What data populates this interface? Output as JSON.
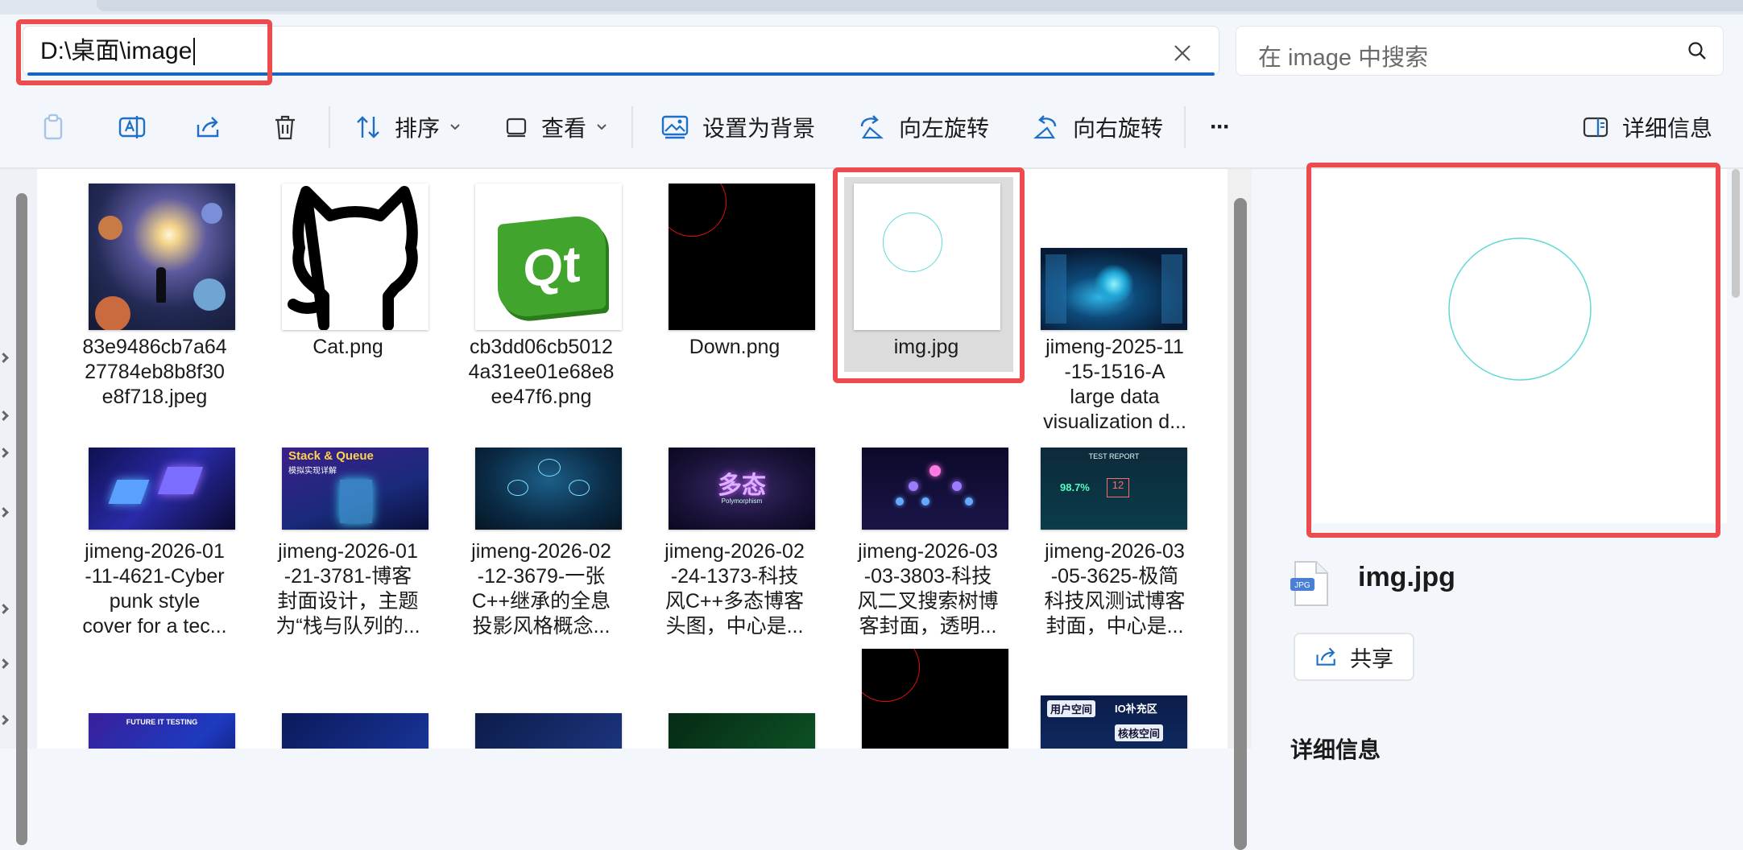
{
  "address": {
    "path": "D:\\桌面\\image",
    "clear_icon": "close-icon"
  },
  "search": {
    "placeholder": "在 image 中搜索",
    "icon": "search-icon"
  },
  "toolbar": {
    "sort_label": "排序",
    "view_label": "查看",
    "set_background_label": "设置为背景",
    "rotate_left_label": "向左旋转",
    "rotate_right_label": "向右旋转",
    "more_label": "···",
    "details_label": "详细信息"
  },
  "files": [
    {
      "name": "83e9486cb7a6427784eb8b8f30e8f718.jpeg",
      "lines": [
        "83e9486cb7a64",
        "27784eb8b8f30",
        "e8f718.jpeg"
      ]
    },
    {
      "name": "Cat.png",
      "lines": [
        "Cat.png"
      ]
    },
    {
      "name": "cb3dd06cb50124a31ee01e68e8ee47f6.png",
      "lines": [
        "cb3dd06cb5012",
        "4a31ee01e68e8",
        "ee47f6.png"
      ]
    },
    {
      "name": "Down.png",
      "lines": [
        "Down.png"
      ]
    },
    {
      "name": "img.jpg",
      "lines": [
        "img.jpg"
      ],
      "selected": true
    },
    {
      "name": "jimeng-2025-11-15-1516-A large data visualization d...",
      "lines": [
        "jimeng-2025-11",
        "-15-1516-A",
        "large data",
        "visualization d..."
      ]
    },
    {
      "name": "jimeng-2026-01-11-4621-Cyberpunk style cover for a tec...",
      "lines": [
        "jimeng-2026-01",
        "-11-4621-Cyber",
        "punk style",
        "cover for a tec..."
      ]
    },
    {
      "name": "jimeng-2026-01-21-3781-博客封面设计，主题为“栈与队列的...",
      "lines": [
        "jimeng-2026-01",
        "-21-3781-博客",
        "封面设计，主题",
        "为“栈与队列的..."
      ]
    },
    {
      "name": "jimeng-2026-02-12-3679-一张C++继承的全息投影风格概念...",
      "lines": [
        "jimeng-2026-02",
        "-12-3679-一张",
        "C++继承的全息",
        "投影风格概念..."
      ]
    },
    {
      "name": "jimeng-2026-02-24-1373-科技风C++多态博客头图，中心是...",
      "lines": [
        "jimeng-2026-02",
        "-24-1373-科技",
        "风C++多态博客",
        "头图，中心是..."
      ]
    },
    {
      "name": "jimeng-2026-03-03-3803-科技风二叉搜索树博客封面，透明...",
      "lines": [
        "jimeng-2026-03",
        "-03-3803-科技",
        "风二叉搜索树博",
        "客封面，透明..."
      ]
    },
    {
      "name": "jimeng-2026-03-05-3625-极简科技风测试博客封面，中心是...",
      "lines": [
        "jimeng-2026-03",
        "-05-3625-极简",
        "科技风测试博客",
        "封面，中心是..."
      ]
    }
  ],
  "thumb_text": {
    "qt_logo": "Qt",
    "stack_queue_title": "Stack & Queue",
    "stack_queue_sub": "模拟实现详解",
    "poly_title": "多态",
    "poly_sub": "Polymorphism",
    "test_report": "TEST REPORT",
    "test_val1": "98.7%",
    "test_val2": "12",
    "future_it": "FUTURE IT TESTING",
    "user_space": "用户空间",
    "io_area": "IO补充区",
    "kernel_space": "核核空间"
  },
  "detail": {
    "file_name": "img.jpg",
    "file_icon_label": "JPG",
    "share_label": "共享",
    "section_header": "详细信息"
  },
  "colors": {
    "accent": "#1565c0",
    "highlight": "#ee4b4f",
    "selected_bg": "#dcdcdc"
  }
}
